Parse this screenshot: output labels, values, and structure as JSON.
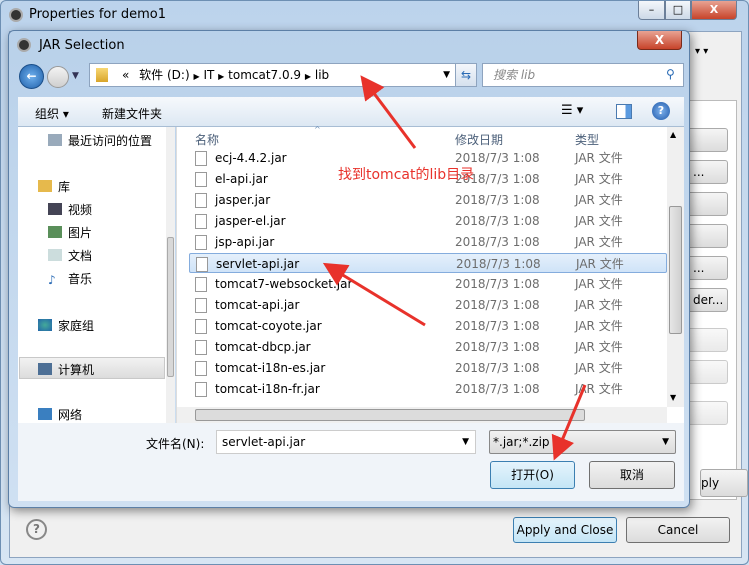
{
  "outer_window": {
    "title": "Properties for demo1",
    "minimize": "–",
    "maximize": "□",
    "close": "X",
    "help_icon": "?",
    "apply_close": "Apply and Close",
    "cancel": "Cancel",
    "partial_buttons": [
      "",
      "...",
      "",
      "",
      "...",
      "der...",
      "",
      "",
      ""
    ],
    "partial_apply": "ply"
  },
  "dialog": {
    "title": "JAR Selection",
    "close": "X",
    "address": {
      "parts": [
        "«",
        "软件 (D:)",
        "IT",
        "tomcat7.0.9",
        "lib"
      ]
    },
    "search_placeholder": "搜索 lib",
    "toolbar": {
      "organize": "组织 ▾",
      "new_folder": "新建文件夹"
    },
    "sidebar": [
      {
        "label": "最近访问的位置",
        "icon": "recent-icon"
      },
      {
        "label": "库",
        "icon": "library-icon"
      },
      {
        "label": "视频",
        "icon": "video-icon"
      },
      {
        "label": "图片",
        "icon": "picture-icon"
      },
      {
        "label": "文档",
        "icon": "document-icon"
      },
      {
        "label": "音乐",
        "icon": "music-icon"
      },
      {
        "label": "家庭组",
        "icon": "homegroup-icon"
      },
      {
        "label": "计算机",
        "icon": "computer-icon"
      },
      {
        "label": "网络",
        "icon": "network-icon"
      }
    ],
    "columns": {
      "name": "名称",
      "date": "修改日期",
      "type": "类型"
    },
    "files": [
      {
        "name": "ecj-4.4.2.jar",
        "date": "2018/7/3 1:08",
        "type": "JAR 文件"
      },
      {
        "name": "el-api.jar",
        "date": "2018/7/3 1:08",
        "type": "JAR 文件"
      },
      {
        "name": "jasper.jar",
        "date": "2018/7/3 1:08",
        "type": "JAR 文件"
      },
      {
        "name": "jasper-el.jar",
        "date": "2018/7/3 1:08",
        "type": "JAR 文件"
      },
      {
        "name": "jsp-api.jar",
        "date": "2018/7/3 1:08",
        "type": "JAR 文件"
      },
      {
        "name": "servlet-api.jar",
        "date": "2018/7/3 1:08",
        "type": "JAR 文件"
      },
      {
        "name": "tomcat7-websocket.jar",
        "date": "2018/7/3 1:08",
        "type": "JAR 文件"
      },
      {
        "name": "tomcat-api.jar",
        "date": "2018/7/3 1:08",
        "type": "JAR 文件"
      },
      {
        "name": "tomcat-coyote.jar",
        "date": "2018/7/3 1:08",
        "type": "JAR 文件"
      },
      {
        "name": "tomcat-dbcp.jar",
        "date": "2018/7/3 1:08",
        "type": "JAR 文件"
      },
      {
        "name": "tomcat-i18n-es.jar",
        "date": "2018/7/3 1:08",
        "type": "JAR 文件"
      },
      {
        "name": "tomcat-i18n-fr.jar",
        "date": "2018/7/3 1:08",
        "type": "JAR 文件"
      }
    ],
    "selected_file": "servlet-api.jar",
    "filename_label": "文件名(N):",
    "filename_value": "servlet-api.jar",
    "filter": "*.jar;*.zip",
    "open": "打开(O)",
    "cancel": "取消"
  },
  "annotation": {
    "text": "找到tomcat的lib目录",
    "color": "#e8322b"
  }
}
